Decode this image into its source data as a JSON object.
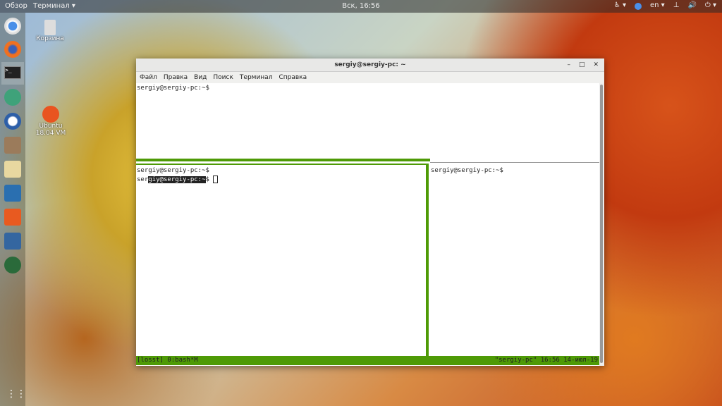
{
  "topbar": {
    "activities": "Обзор",
    "app_menu": "Терминал ▾",
    "clock": "Вск, 16:56",
    "lang": "en ▾",
    "accessibility": "♿ ▾",
    "network": "⊥",
    "volume": "🔊",
    "power": "⏻ ▾"
  },
  "desktop": {
    "trash": "Корзина",
    "vm_line1": "Ubuntu",
    "vm_line2": "18.04 VM"
  },
  "window": {
    "title": "sergiy@sergiy-pc: ~",
    "controls": [
      "–",
      "□",
      "✕"
    ],
    "menu": [
      "Файл",
      "Правка",
      "Вид",
      "Поиск",
      "Терминал",
      "Справка"
    ]
  },
  "panes": {
    "top": [
      "sergiy@sergiy-pc:~$"
    ],
    "left_line1": "sergiy@sergiy-pc:~$",
    "left_line2_a": "ser",
    "left_line2_sel": "giy@sergiy-pc:~",
    "left_line2_b": "$ ",
    "right": [
      "sergiy@sergiy-pc:~$"
    ]
  },
  "tmux": {
    "left": "[losst] 0:bash*M",
    "right": "\"sergiy-pc\" 16:56 14-июл-19"
  },
  "colors": {
    "tmux_green": "#4e9a06"
  }
}
